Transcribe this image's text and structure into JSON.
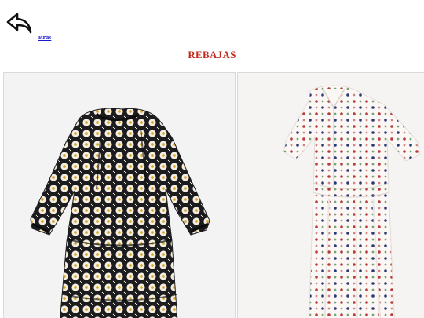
{
  "header": {
    "back_label": "atrás",
    "back_icon": "reply-arrow-icon"
  },
  "page": {
    "title": "REBAJAS"
  },
  "products": [
    {
      "image": "black-daisy-print-dress",
      "colors": {
        "base": "#1c1c1e",
        "petal": "#f4efe2",
        "center": "#d9a52e"
      }
    },
    {
      "image": "white-polka-dot-shirt-dress",
      "colors": {
        "base": "#fbf7f4",
        "dot_a": "#b83a3a",
        "dot_b": "#2c3a78",
        "dot_c": "#5a8a5a"
      }
    }
  ],
  "colors": {
    "title": "#c0281c",
    "link": "#1a1ad6",
    "divider": "#bdbdbd"
  }
}
